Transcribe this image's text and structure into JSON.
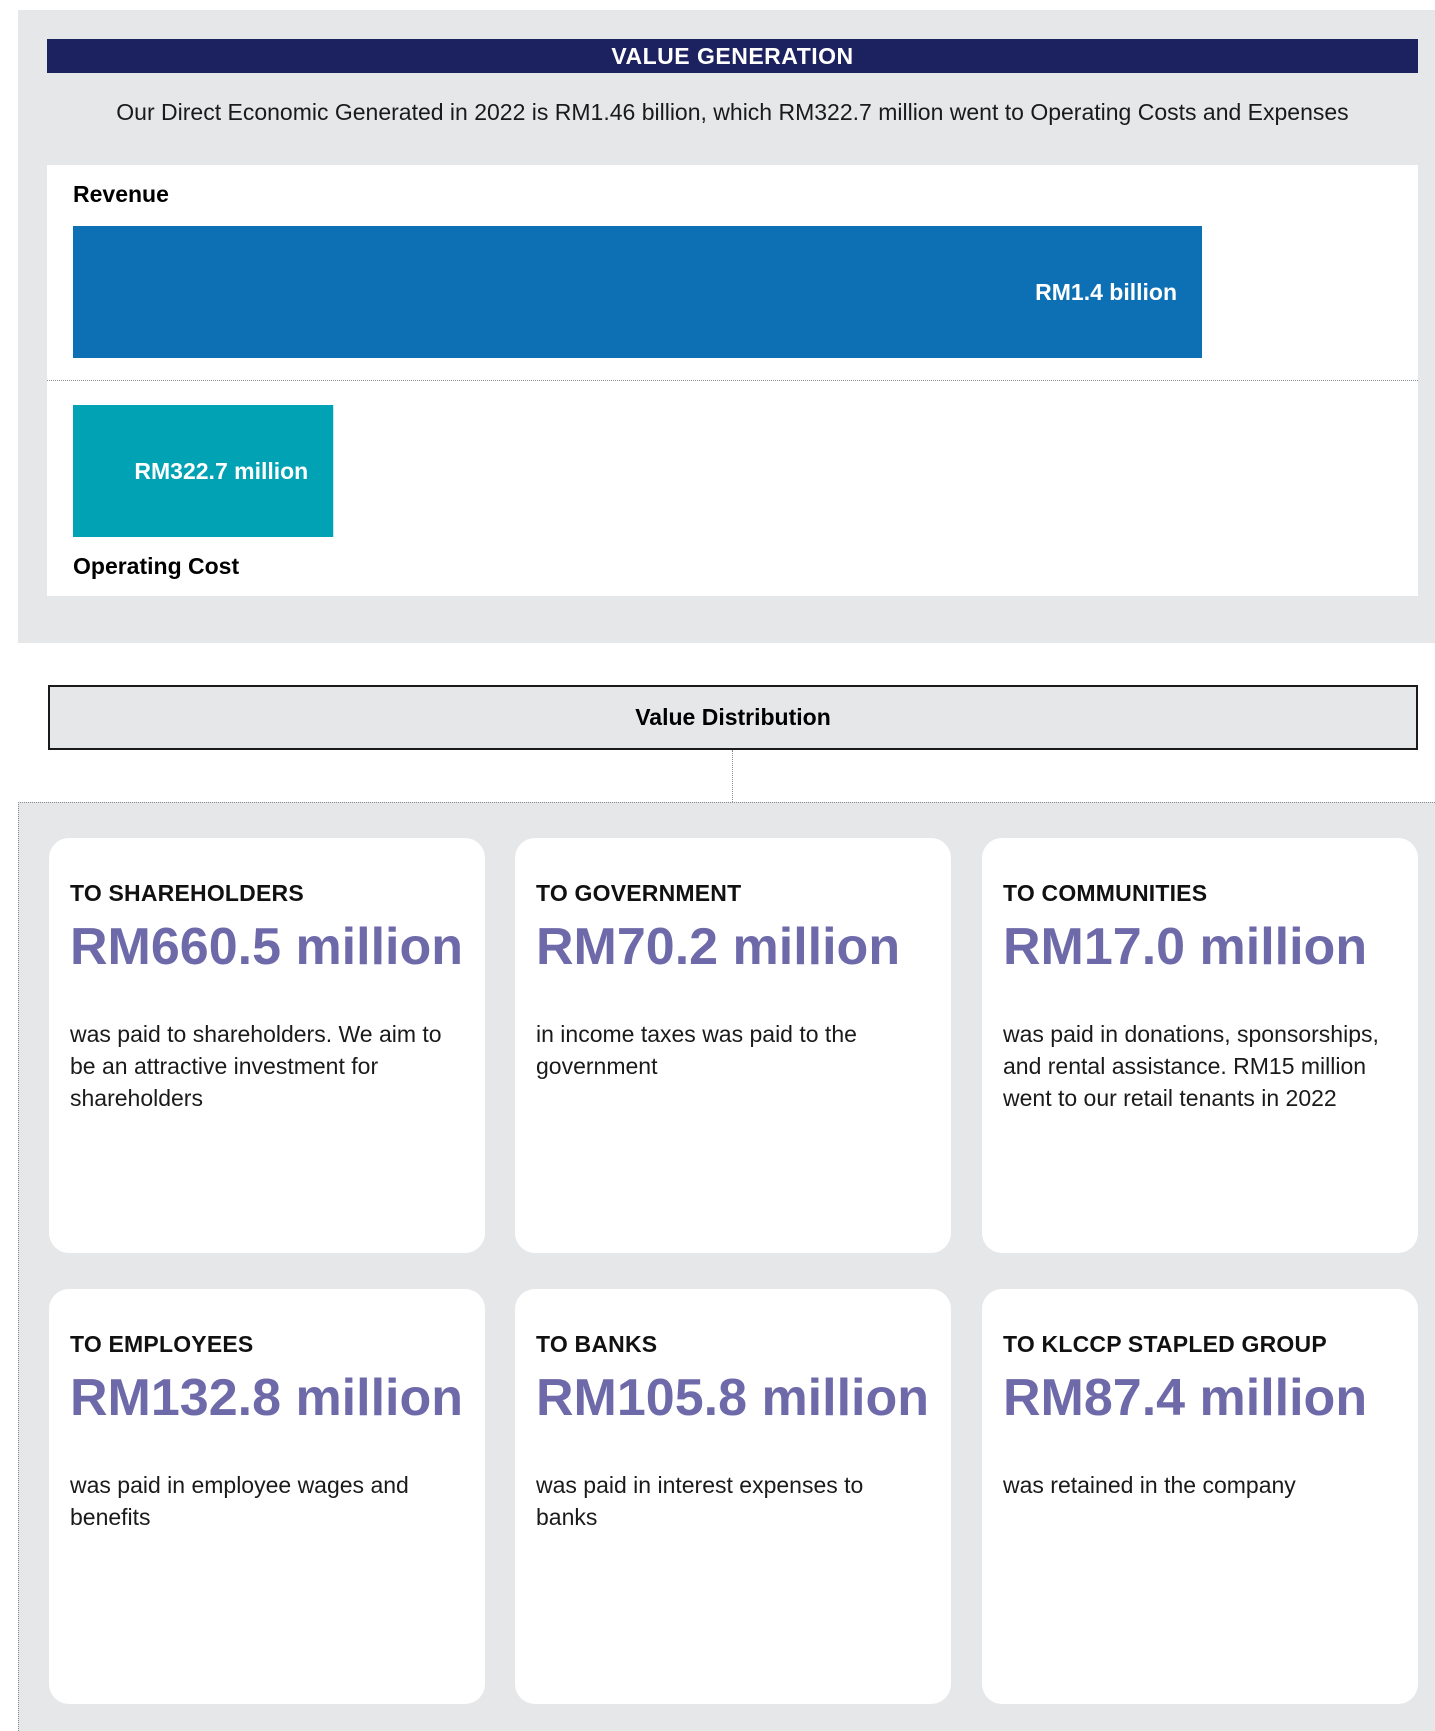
{
  "value_generation": {
    "title": "VALUE GENERATION",
    "intro": "Our Direct Economic Generated in 2022 is RM1.46 billion, which RM322.7 million went to Operating Costs and Expenses"
  },
  "chart_data": {
    "type": "bar",
    "categories": [
      "Revenue",
      "Operating Cost"
    ],
    "values": [
      1400,
      322.7
    ],
    "value_labels": [
      "RM1.4 billion",
      "RM322.7 million"
    ],
    "colors": [
      "#0d70b5",
      "#00a2b3"
    ],
    "unit": "RM million"
  },
  "value_distribution": {
    "title": "Value Distribution",
    "cards": [
      {
        "title": "TO SHAREHOLDERS",
        "amount": "RM660.5 million",
        "description": "was paid to shareholders. We aim to be an attractive investment for shareholders"
      },
      {
        "title": "TO GOVERNMENT",
        "amount": "RM70.2 million",
        "description": "in income taxes was paid to the government"
      },
      {
        "title": "TO COMMUNITIES",
        "amount": "RM17.0 million",
        "description": "was paid in donations, sponsorships, and rental assistance. RM15 million went to our retail tenants in 2022"
      },
      {
        "title": "TO EMPLOYEES",
        "amount": "RM132.8 million",
        "description": "was paid in employee wages and benefits"
      },
      {
        "title": "TO BANKS",
        "amount": "RM105.8 million",
        "description": "was paid in interest expenses to banks"
      },
      {
        "title": "TO KLCCP STAPLED GROUP",
        "amount": "RM87.4 million",
        "description": "was retained in the company"
      }
    ]
  }
}
